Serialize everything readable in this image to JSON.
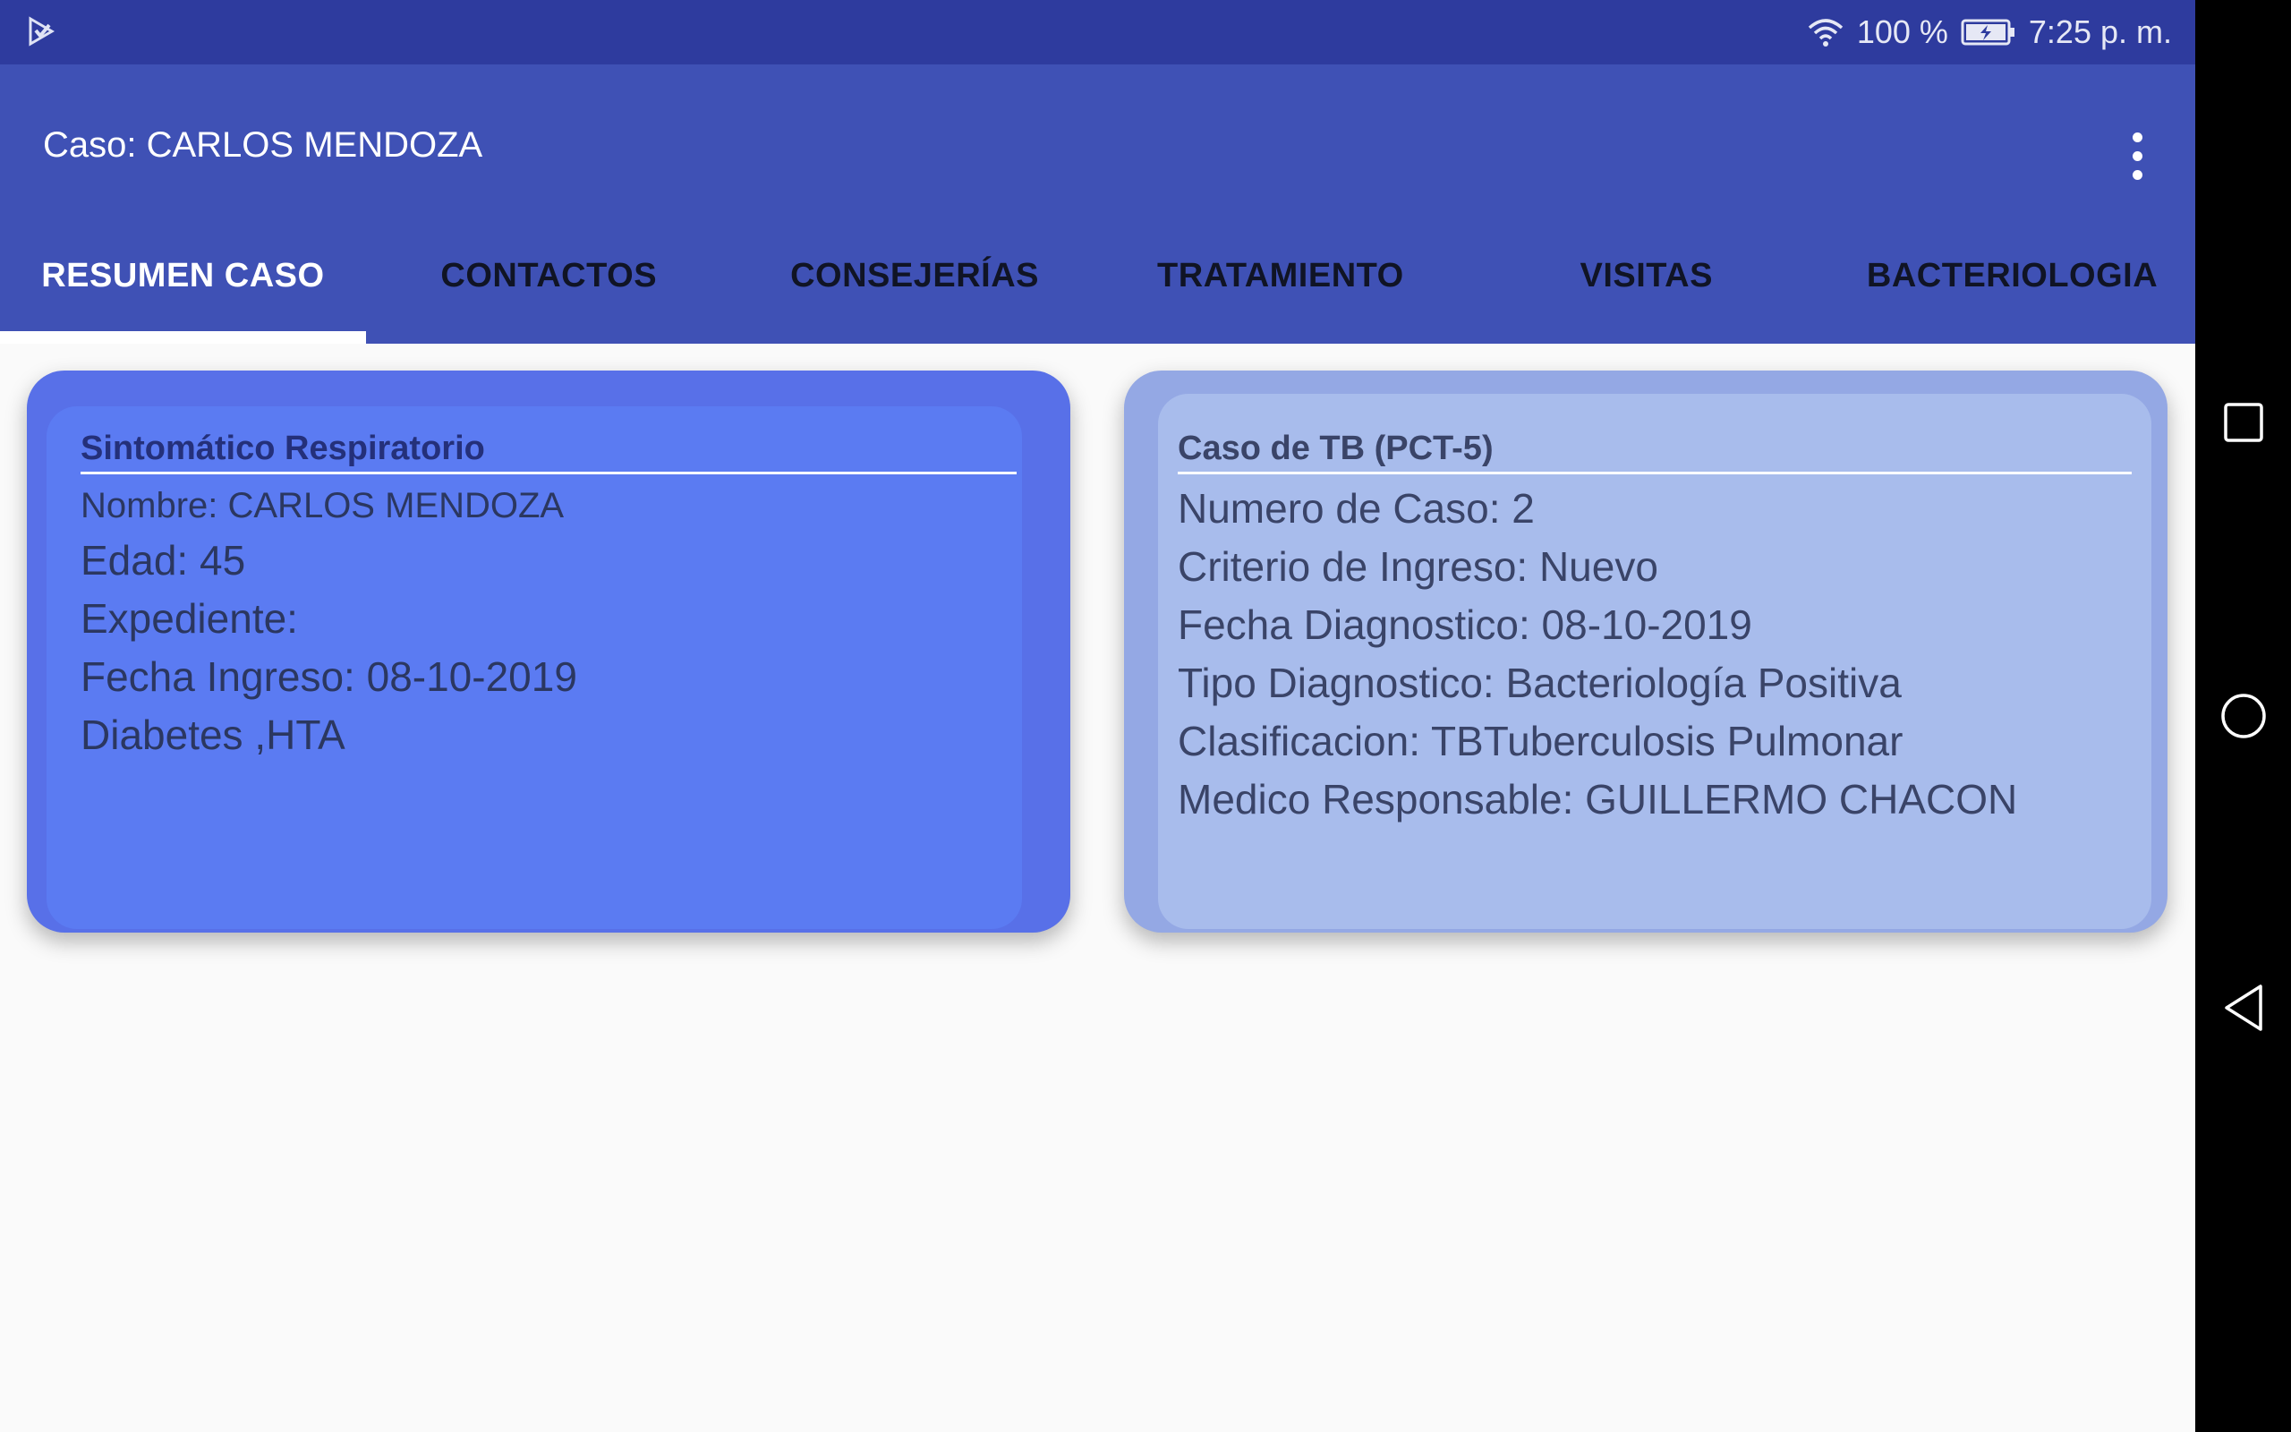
{
  "status_bar": {
    "battery_percent": "100 %",
    "time": "7:25 p. m."
  },
  "app_bar": {
    "title": "Caso: CARLOS MENDOZA"
  },
  "tabs": [
    {
      "label": "RESUMEN CASO",
      "active": true
    },
    {
      "label": "CONTACTOS",
      "active": false
    },
    {
      "label": "CONSEJERÍAS",
      "active": false
    },
    {
      "label": "TRATAMIENTO",
      "active": false
    },
    {
      "label": "VISITAS",
      "active": false
    },
    {
      "label": "BACTERIOLOGIA",
      "active": false
    }
  ],
  "card_left": {
    "heading": "Sintomático Respiratorio",
    "nombre": "Nombre: CARLOS MENDOZA",
    "edad": "Edad: 45",
    "expediente": "Expediente:",
    "fecha_ingreso": "Fecha Ingreso: 08-10-2019",
    "comorbilidades": "Diabetes ,HTA"
  },
  "card_right": {
    "heading": "Caso de TB (PCT-5)",
    "numero_caso": "Numero de Caso: 2",
    "criterio_ingreso": "Criterio de Ingreso: Nuevo",
    "fecha_diagnostico": "Fecha Diagnostico: 08-10-2019",
    "tipo_diagnostico": "Tipo Diagnostico: Bacteriología Positiva",
    "clasificacion": "Clasificacion: TBTuberculosis Pulmonar",
    "medico_responsable": "Medico Responsable: GUILLERMO CHACON"
  },
  "colors": {
    "status_bar": "#2e3b9e",
    "app_bar": "#3f51b5",
    "card_left": "#5b7bf2",
    "card_right": "#a8bcec"
  },
  "icons": {
    "notification": "play-store-download-icon",
    "wifi": "wifi-icon",
    "battery": "battery-charging-icon",
    "overflow": "more-vert-icon",
    "nav_recents": "square-icon",
    "nav_home": "circle-icon",
    "nav_back": "triangle-back-icon"
  }
}
